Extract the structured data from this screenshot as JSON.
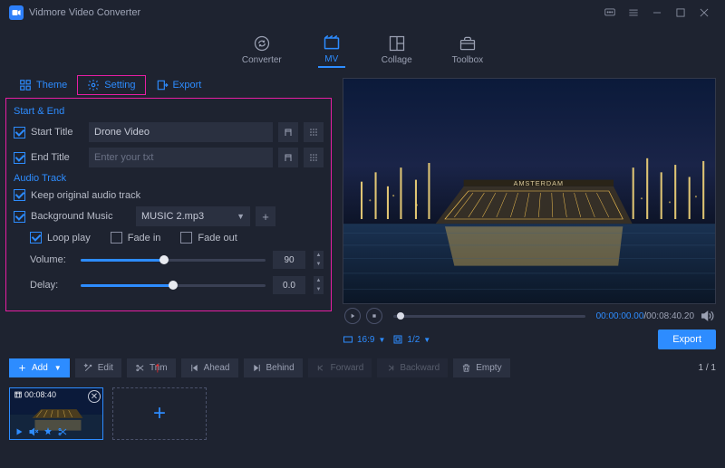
{
  "app": {
    "title": "Vidmore Video Converter"
  },
  "mainnav": {
    "converter": "Converter",
    "mv": "MV",
    "collage": "Collage",
    "toolbox": "Toolbox"
  },
  "subtabs": {
    "theme": "Theme",
    "setting": "Setting",
    "export": "Export"
  },
  "settings": {
    "start_end_head": "Start & End",
    "start_title_label": "Start Title",
    "start_title_value": "Drone Video",
    "end_title_label": "End Title",
    "end_title_placeholder": "Enter your txt",
    "audio_track_head": "Audio Track",
    "keep_original_label": "Keep original audio track",
    "bg_music_label": "Background Music",
    "bg_music_value": "MUSIC 2.mp3",
    "loop_label": "Loop play",
    "fade_in_label": "Fade in",
    "fade_out_label": "Fade out",
    "volume_label": "Volume:",
    "volume_value": "90",
    "delay_label": "Delay:",
    "delay_value": "0.0"
  },
  "preview": {
    "time_current": "00:00:00.00",
    "time_total": "00:08:40.20",
    "aspect_label": "16:9",
    "zoom_label": "1/2",
    "export_label": "Export"
  },
  "toolbar": {
    "add": "Add",
    "edit": "Edit",
    "trim": "Trim",
    "ahead": "Ahead",
    "behind": "Behind",
    "forward": "Forward",
    "backward": "Backward",
    "empty": "Empty",
    "page": "1 / 1"
  },
  "clip": {
    "duration": "00:08:40"
  }
}
